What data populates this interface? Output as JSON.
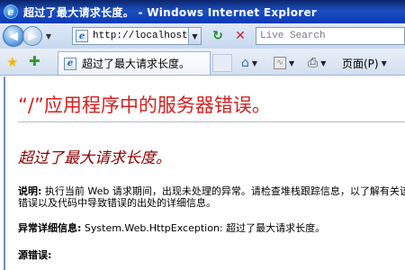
{
  "window": {
    "title": "超过了最大请求长度。 - Windows Internet Explorer"
  },
  "navbar": {
    "address": "http://localhost/",
    "search_placeholder": "Live Search"
  },
  "tabbar": {
    "tab_title": "超过了最大请求长度。",
    "page_menu": "页面(P)"
  },
  "content": {
    "error_title": "“/”应用程序中的服务器错误。",
    "error_subtitle": "超过了最大请求长度。",
    "description_label": "说明:",
    "description_text": "执行当前 Web 请求期间，出现未处理的异常。请检查堆栈跟踪信息，以了解有关该错误以及代码中导致错误的出处的详细信息。",
    "exception_label": "异常详细信息:",
    "exception_text": "System.Web.HttpException: 超过了最大请求长度。",
    "source_label": "源错误:"
  },
  "colors": {
    "error_red": "#d42020",
    "subtitle_red": "#8b0000",
    "titlebar_blue": "#0a39b5"
  }
}
